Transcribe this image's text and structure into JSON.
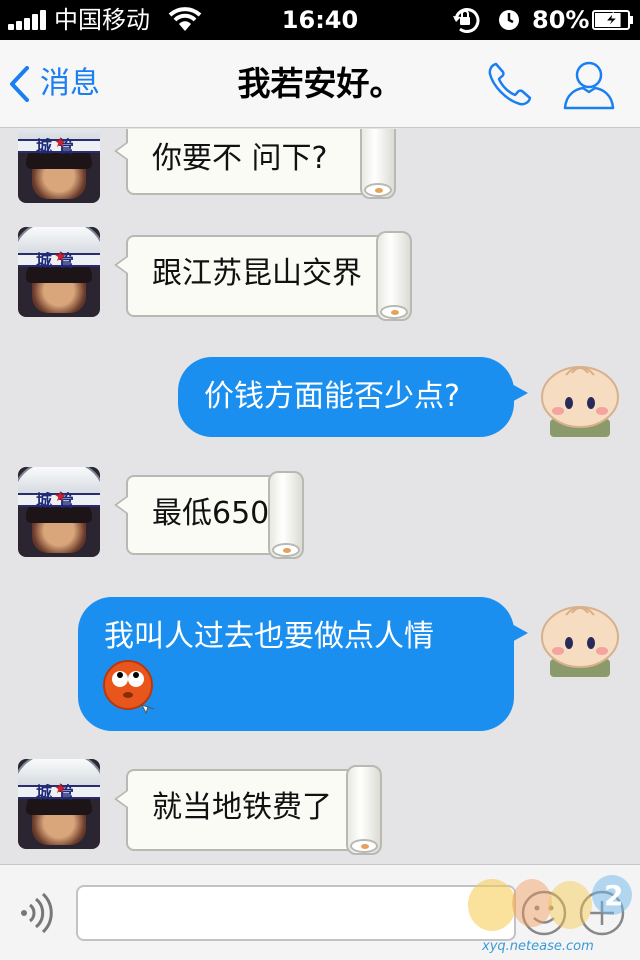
{
  "status_bar": {
    "carrier": "中国移动",
    "time": "16:40",
    "battery": "80%",
    "battery_level": 0.8
  },
  "nav": {
    "back_label": "消息",
    "title": "我若安好。"
  },
  "messages": [
    {
      "side": "left",
      "avatar": "guard-avatar",
      "text": "你要不 问下?"
    },
    {
      "side": "left",
      "avatar": "guard-avatar",
      "text": "跟江苏昆山交界"
    },
    {
      "side": "right",
      "avatar": "bun-avatar",
      "text": "价钱方面能否少点?"
    },
    {
      "side": "left",
      "avatar": "guard-avatar",
      "text": "最低650"
    },
    {
      "side": "right",
      "avatar": "bun-avatar",
      "text": "我叫人过去也要做点人情",
      "emoji": "rolling-eyes-emoji"
    },
    {
      "side": "left",
      "avatar": "guard-avatar",
      "text": "就当地铁费了"
    }
  ],
  "avatar_guard": {
    "helmet_text": "城管"
  },
  "input": {
    "value": "",
    "placeholder": ""
  },
  "watermark": {
    "url": "xyq.netease.com"
  },
  "colors": {
    "accent": "#1a7ff0",
    "bubble_blue": "#1a8ff0",
    "bubble_paper": "#fbfbf6",
    "background": "#e4e4e6"
  },
  "icons": [
    "signal-icon",
    "wifi-icon",
    "rotation-lock-icon",
    "alarm-icon",
    "battery-icon",
    "back-chevron-icon",
    "phone-icon",
    "contact-icon",
    "voice-icon",
    "emoji-icon",
    "plus-icon"
  ]
}
